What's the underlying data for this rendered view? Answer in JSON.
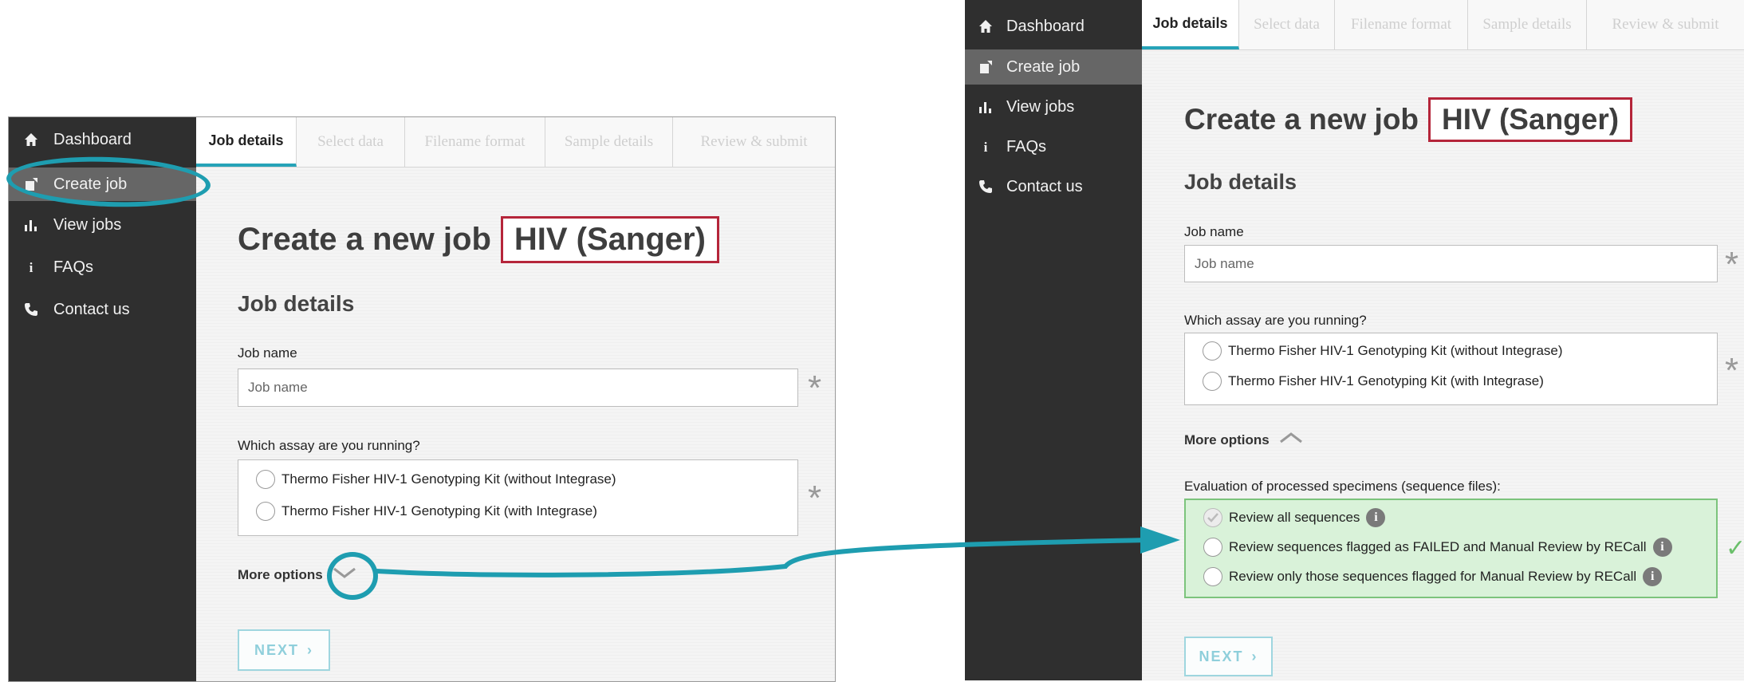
{
  "colors": {
    "accent": "#26a3b8",
    "highlight": "#1e9db0",
    "badge_border": "#b5253a",
    "success": "#7cc47c",
    "sidebar_bg": "#2f2f2f",
    "sidebar_active": "#666666"
  },
  "sidebar": {
    "items": [
      {
        "label": "Dashboard",
        "icon": "home-icon"
      },
      {
        "label": "Create job",
        "icon": "create-job-icon"
      },
      {
        "label": "View jobs",
        "icon": "bar-chart-icon"
      },
      {
        "label": "FAQs",
        "icon": "info-icon"
      },
      {
        "label": "Contact us",
        "icon": "phone-icon"
      }
    ],
    "active_index": 1
  },
  "tabs": [
    "Job details",
    "Select data",
    "Filename format",
    "Sample details",
    "Review & submit"
  ],
  "page": {
    "title": "Create a new job",
    "badge": "HIV (Sanger)"
  },
  "form": {
    "section_title": "Job details",
    "job_name_label": "Job name",
    "job_name_placeholder": "Job name",
    "required_mark": "*",
    "assay_label": "Which assay are you running?",
    "assay_options": [
      "Thermo Fisher HIV-1 Genotyping Kit (without Integrase)",
      "Thermo Fisher HIV-1 Genotyping Kit (with Integrase)"
    ],
    "more_options_label": "More options",
    "next_label": "NEXT"
  },
  "expanded": {
    "eval_label": "Evaluation of processed specimens (sequence files):",
    "eval_options": [
      {
        "label": "Review all sequences",
        "checked": true
      },
      {
        "label": "Review sequences flagged as FAILED and Manual Review by RECall",
        "checked": false
      },
      {
        "label": "Review only those sequences flagged for Manual Review by RECall",
        "checked": false
      }
    ],
    "valid_mark": "✓"
  }
}
